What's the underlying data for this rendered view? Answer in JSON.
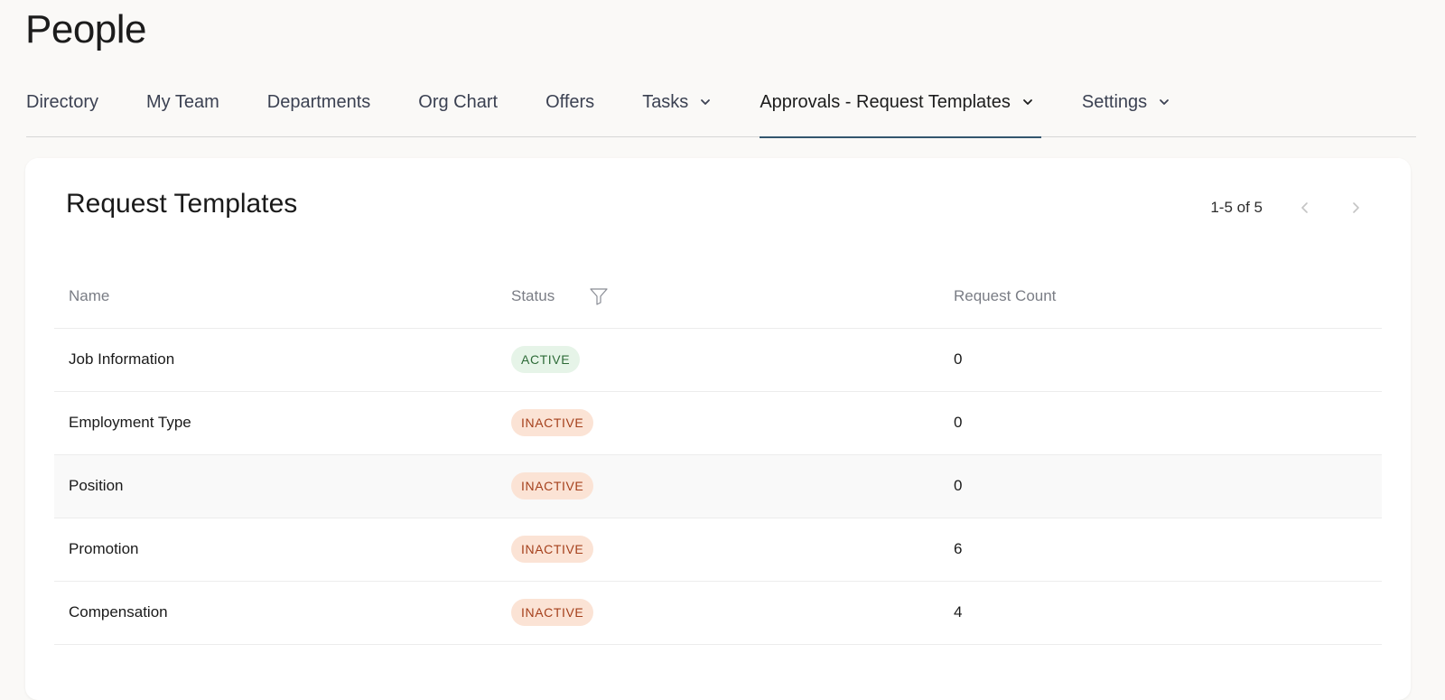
{
  "page": {
    "title": "People"
  },
  "nav": {
    "tabs": [
      {
        "label": "Directory",
        "dropdown": false,
        "active": false
      },
      {
        "label": "My Team",
        "dropdown": false,
        "active": false
      },
      {
        "label": "Departments",
        "dropdown": false,
        "active": false
      },
      {
        "label": "Org Chart",
        "dropdown": false,
        "active": false
      },
      {
        "label": "Offers",
        "dropdown": false,
        "active": false
      },
      {
        "label": "Tasks",
        "dropdown": true,
        "active": false
      },
      {
        "label": "Approvals - Request Templates",
        "dropdown": true,
        "active": true
      },
      {
        "label": "Settings",
        "dropdown": true,
        "active": false
      }
    ]
  },
  "card": {
    "title": "Request Templates",
    "pagination": {
      "range": "1-5 of 5",
      "prev_icon": "chevron-left-icon",
      "next_icon": "chevron-right-icon"
    }
  },
  "table": {
    "headers": {
      "name": "Name",
      "status": "Status",
      "count": "Request Count"
    },
    "filter_icon": "filter-icon",
    "rows": [
      {
        "name": "Job Information",
        "status": "ACTIVE",
        "count": "0"
      },
      {
        "name": "Employment Type",
        "status": "INACTIVE",
        "count": "0"
      },
      {
        "name": "Position",
        "status": "INACTIVE",
        "count": "0"
      },
      {
        "name": "Promotion",
        "status": "INACTIVE",
        "count": "6"
      },
      {
        "name": "Compensation",
        "status": "INACTIVE",
        "count": "4"
      }
    ]
  },
  "colors": {
    "active_tab_underline": "#33566e",
    "active_badge_bg": "#e6f4e8",
    "active_badge_text": "#2e6b38",
    "inactive_badge_bg": "#fbe3d5",
    "inactive_badge_text": "#a5401c"
  }
}
